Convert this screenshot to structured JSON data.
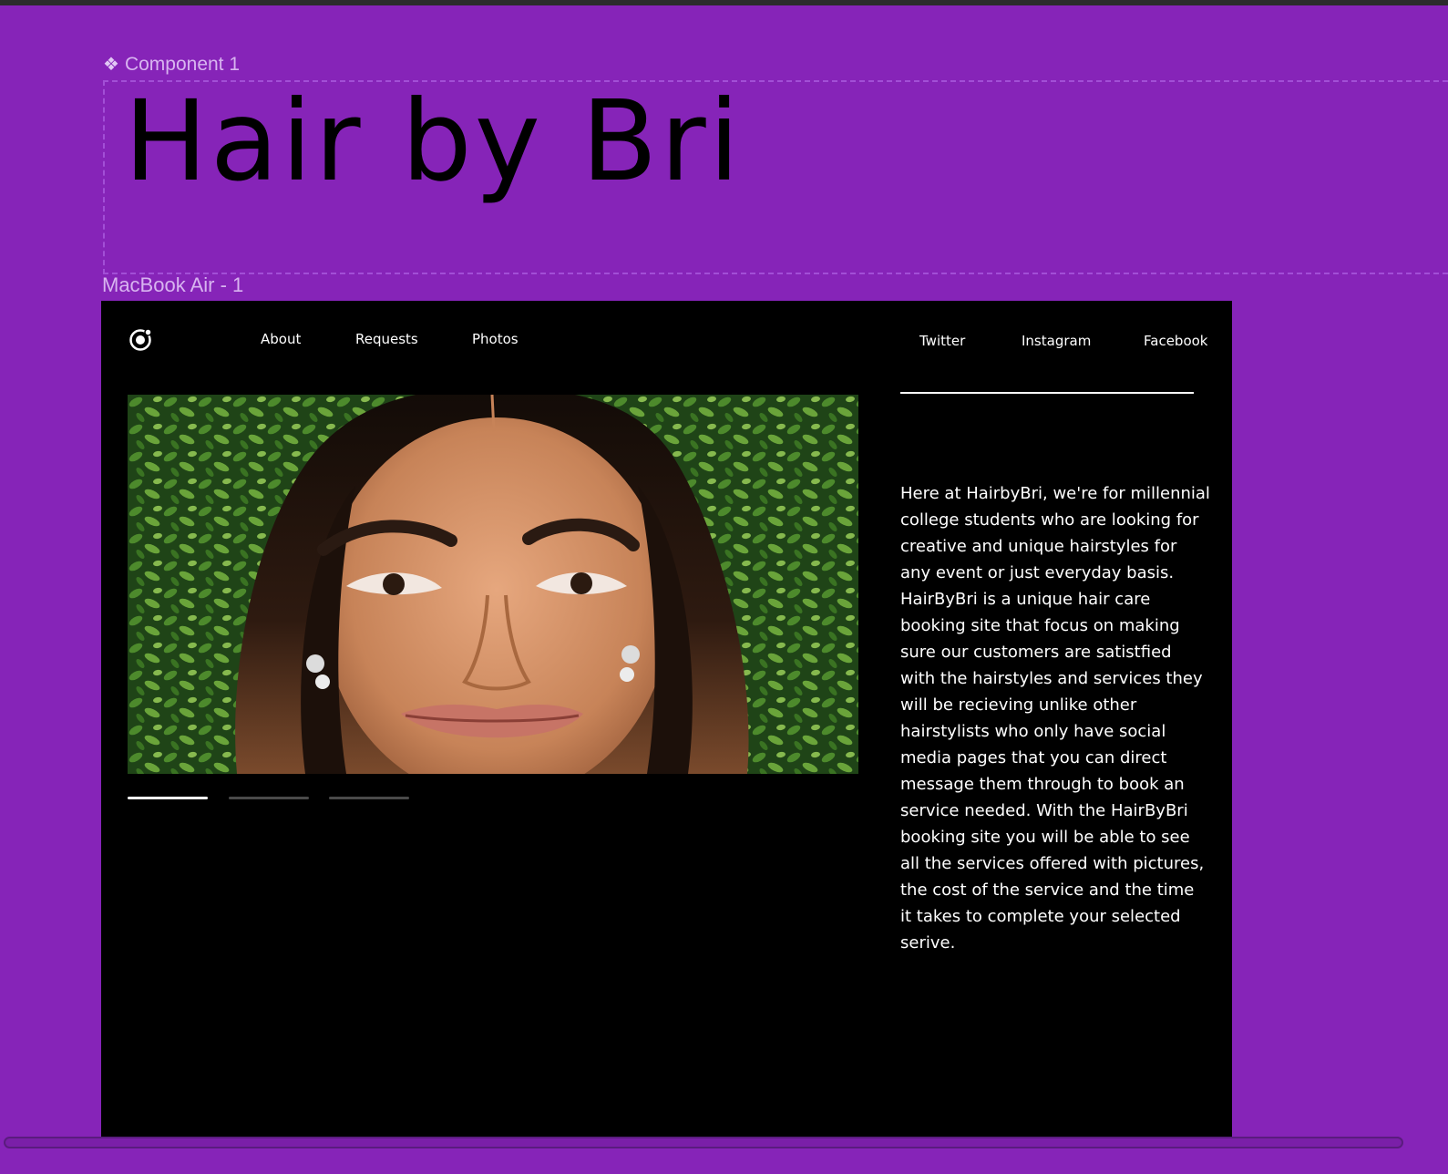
{
  "canvas": {
    "component_label": "Component 1",
    "title": "Hair by Bri",
    "frame_label": "MacBook Air - 1"
  },
  "site": {
    "nav": [
      "About",
      "Requests",
      "Photos"
    ],
    "social": [
      "Twitter",
      "Instagram",
      "Facebook"
    ],
    "about_text": "Here at HairbyBri, we're for millennial college students who are looking for creative and unique hairstyles for any event or just everyday basis. HairByBri is a unique hair care booking site that focus on making sure our customers are satistfied with the hairstyles and services they will be recieving unlike other hairstylists who only have social media pages that you can direct message them through to book an service needed. With the HairByBri booking site you will be able to see all the services offered with pictures, the cost of the service and the time it takes to complete your selected serive.",
    "carousel": {
      "slide_count": 3,
      "active_index": 0
    }
  },
  "colors": {
    "canvas_bg": "#8624b8",
    "device_bg": "#000000",
    "accent_text": "#d8b4f0"
  },
  "icons": {
    "component": "component-diamond-icon",
    "logo": "logo-ring-icon"
  }
}
